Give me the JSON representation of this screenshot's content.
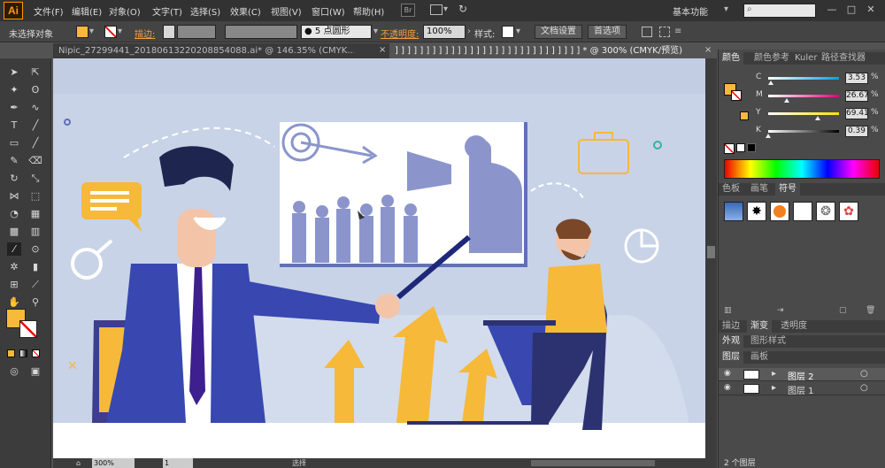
{
  "app": {
    "logo": "Ai"
  },
  "menu": [
    "文件(F)",
    "编辑(E)",
    "对象(O)",
    "文字(T)",
    "选择(S)",
    "效果(C)",
    "视图(V)",
    "窗口(W)",
    "帮助(H)"
  ],
  "menubar": {
    "bridge": "Br",
    "workspace": "基本功能"
  },
  "control_bar": {
    "selection": "未选择对象",
    "stroke_label": "描边:",
    "brush": "5 点圆形",
    "opacity_label": "不透明度:",
    "opacity_value": "100%",
    "style_label": "样式:",
    "doc_settings": "文档设置",
    "preferences": "首选项"
  },
  "tabs": [
    {
      "label": "Nipic_27299441_20180613220208854088.ai* @ 146.35% (CMYK..."
    },
    {
      "label": "] ] ] ] ] ] ] ] ] ] ] ] ] ] ] ] ] ] ] ] ] ] ] ] ] ] ] ] ] ] * @ 300% (CMYK/预览)"
    }
  ],
  "color_panel": {
    "tabs": [
      "颜色",
      "颜色参考",
      "Kuler",
      "路径查找器"
    ],
    "sliders": [
      {
        "label": "C",
        "value": "3.53",
        "pos": 0.0353,
        "grad": "linear-gradient(90deg,#fff,#00a0e0)"
      },
      {
        "label": "M",
        "value": "26.67",
        "pos": 0.2667,
        "grad": "linear-gradient(90deg,#fff,#e8007a)"
      },
      {
        "label": "Y",
        "value": "69.41",
        "pos": 0.6941,
        "grad": "linear-gradient(90deg,#fff,#ffe000)"
      },
      {
        "label": "K",
        "value": "0.39",
        "pos": 0.0039,
        "grad": "linear-gradient(90deg,#fff,#000)"
      }
    ],
    "fill": "#f6b93a"
  },
  "symbols_panel": {
    "tabs": [
      "色板",
      "画笔",
      "符号"
    ]
  },
  "gradient_panel": {
    "tabs": [
      "描边",
      "渐变",
      "透明度"
    ]
  },
  "appearance_panel": {
    "tabs": [
      "外观",
      "图形样式"
    ]
  },
  "layers_panel": {
    "tabs": [
      "图层",
      "画板"
    ],
    "layers": [
      {
        "name": "图层 2"
      },
      {
        "name": "图层 1"
      }
    ],
    "count": "2 个图层"
  },
  "status_bar": {
    "zoom": "300%",
    "page": "1",
    "mode": "选择"
  }
}
